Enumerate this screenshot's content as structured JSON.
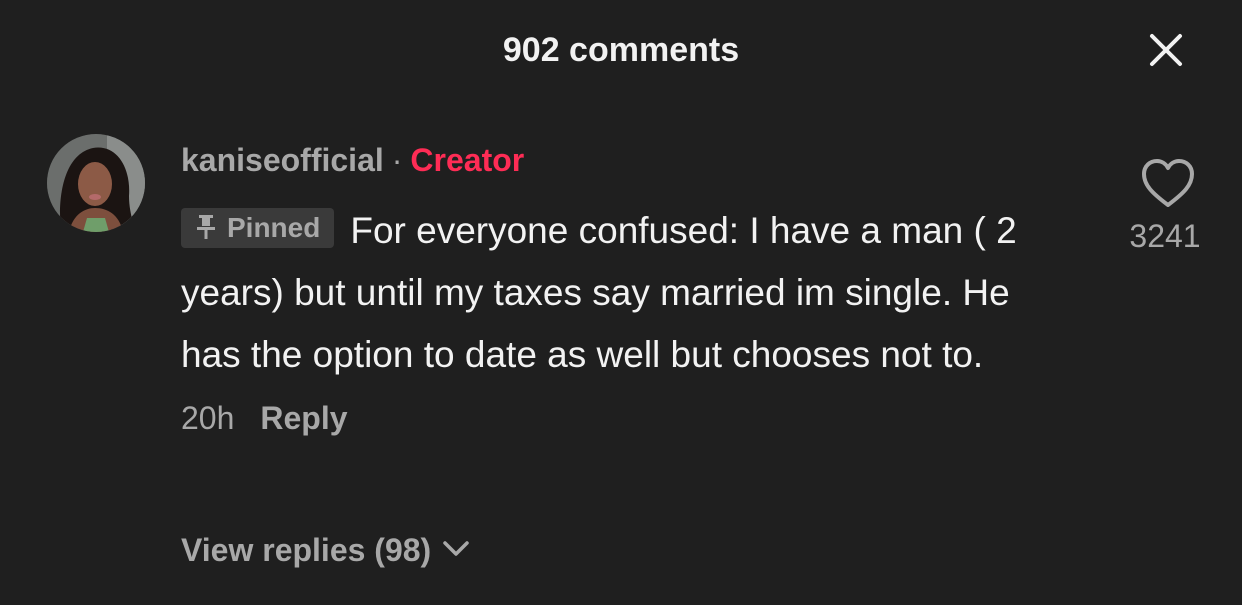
{
  "header": {
    "title": "902 comments"
  },
  "icons": {
    "close": "close-icon",
    "like": "heart-icon",
    "pin": "pin-icon",
    "chevron": "chevron-down-icon"
  },
  "colors": {
    "background": "#1f1f1f",
    "creator_accent": "#fe2c55",
    "muted_text": "#a8a8a8"
  },
  "comment": {
    "username": "kaniseofficial",
    "separator": "·",
    "badge": "Creator",
    "pinned_label": "Pinned",
    "text": "For everyone confused: I have a man ( 2 years) but until my taxes say married im single. He has the option to date as well but chooses not to.",
    "time": "20h",
    "reply_label": "Reply",
    "like_count": "3241",
    "view_replies_label": "View replies (98)"
  }
}
